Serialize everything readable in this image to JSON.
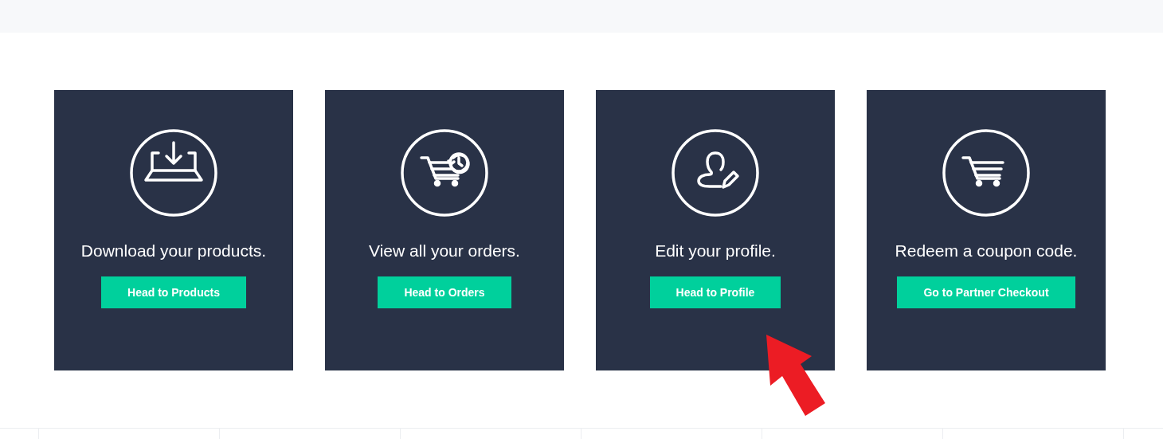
{
  "cards": [
    {
      "text": "Download your products.",
      "button": "Head to Products"
    },
    {
      "text": "View all your orders.",
      "button": "Head to Orders"
    },
    {
      "text": "Edit your profile.",
      "button": "Head to Profile"
    },
    {
      "text": "Redeem a coupon code.",
      "button": "Go to Partner Checkout"
    }
  ]
}
